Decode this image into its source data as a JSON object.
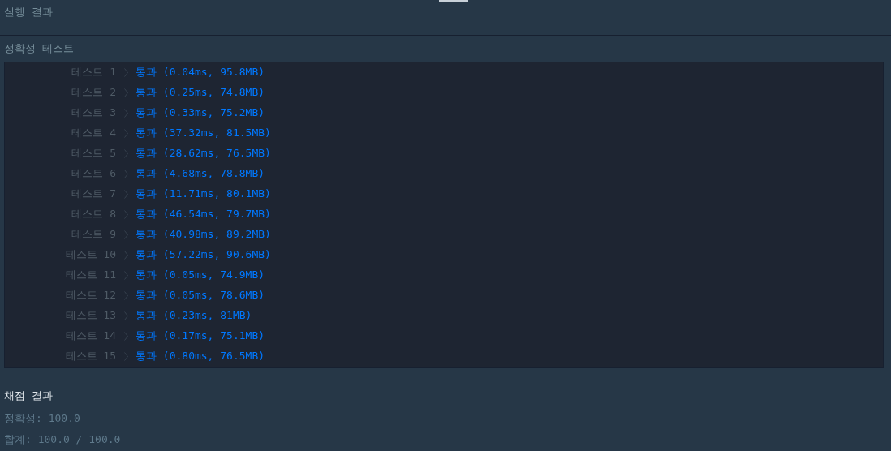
{
  "header": {
    "title": "실행 결과"
  },
  "tests": {
    "title": "정확성  테스트",
    "rows": [
      {
        "label": "테스트 1",
        "result": "통과 (0.04ms, 95.8MB)"
      },
      {
        "label": "테스트 2",
        "result": "통과 (0.25ms, 74.8MB)"
      },
      {
        "label": "테스트 3",
        "result": "통과 (0.33ms, 75.2MB)"
      },
      {
        "label": "테스트 4",
        "result": "통과 (37.32ms, 81.5MB)"
      },
      {
        "label": "테스트 5",
        "result": "통과 (28.62ms, 76.5MB)"
      },
      {
        "label": "테스트 6",
        "result": "통과 (4.68ms, 78.8MB)"
      },
      {
        "label": "테스트 7",
        "result": "통과 (11.71ms, 80.1MB)"
      },
      {
        "label": "테스트 8",
        "result": "통과 (46.54ms, 79.7MB)"
      },
      {
        "label": "테스트 9",
        "result": "통과 (40.98ms, 89.2MB)"
      },
      {
        "label": "테스트 10",
        "result": "통과 (57.22ms, 90.6MB)"
      },
      {
        "label": "테스트 11",
        "result": "통과 (0.05ms, 74.9MB)"
      },
      {
        "label": "테스트 12",
        "result": "통과 (0.05ms, 78.6MB)"
      },
      {
        "label": "테스트 13",
        "result": "통과 (0.23ms, 81MB)"
      },
      {
        "label": "테스트 14",
        "result": "통과 (0.17ms, 75.1MB)"
      },
      {
        "label": "테스트 15",
        "result": "통과 (0.80ms, 76.5MB)"
      }
    ]
  },
  "grading": {
    "title": "채점 결과",
    "lines": [
      "정확성: 100.0",
      "합계: 100.0 / 100.0"
    ]
  }
}
